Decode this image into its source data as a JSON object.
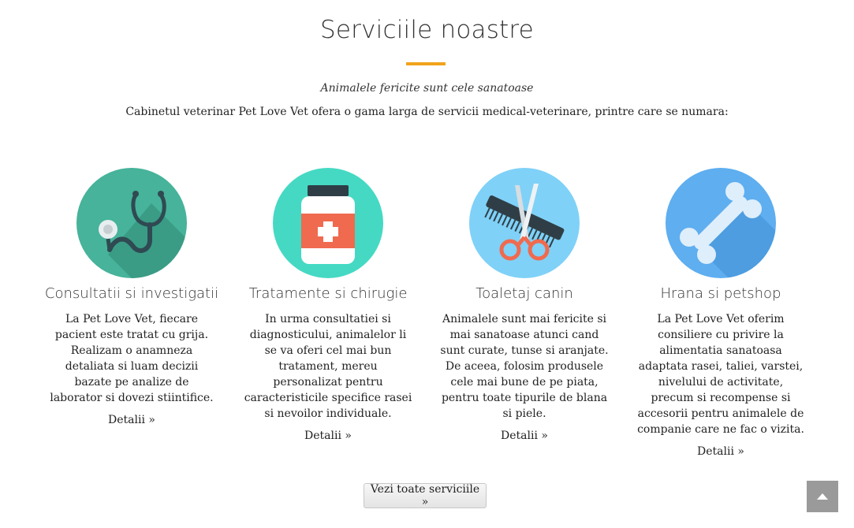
{
  "header": {
    "title": "Serviciile noastre",
    "tagline": "Animalele fericite sunt cele sanatoase",
    "intro": "Cabinetul veterinar Pet Love Vet ofera o gama larga de servicii medical-veterinare, printre care se numara:",
    "accent_color": "#f2a31b"
  },
  "services": [
    {
      "icon": "stethoscope-icon",
      "icon_bg": "#46b39a",
      "title": "Consultatii si investigatii",
      "description": "La Pet Love Vet, fiecare pacient este tratat cu grija. Realizam o anamneza detaliata si luam decizii bazate pe analize de laborator si dovezi stiintifice.",
      "link": "Detalii »"
    },
    {
      "icon": "medicine-bottle-icon",
      "icon_bg": "#45d9c3",
      "title": "Tratamente si chirugie",
      "description": "In urma consultatiei si diagnosticului, animalelor li se va oferi cel mai bun tratament, mereu personalizat pentru caracteristicile specifice rasei si nevoilor individuale.",
      "link": "Detalii »"
    },
    {
      "icon": "comb-scissors-icon",
      "icon_bg": "#7fd1f7",
      "title": "Toaletaj canin",
      "description": "Animalele sunt mai fericite si mai sanatoase atunci cand sunt curate, tunse si aranjate. De aceea, folosim produsele cele mai bune de pe piata, pentru toate tipurile de blana si piele.",
      "link": "Detalii »"
    },
    {
      "icon": "bone-icon",
      "icon_bg": "#5eaef0",
      "title": "Hrana si petshop",
      "description": "La Pet Love Vet oferim consiliere cu privire la alimentatia sanatoasa adaptata rasei, taliei, varstei, nivelului de activitate, precum si recompense si accesorii pentru animalele de companie care ne fac o vizita.",
      "link": "Detalii »"
    }
  ],
  "footer": {
    "all_services_button": "Vezi toate serviciile »",
    "scroll_top_icon": "chevron-up-icon"
  }
}
